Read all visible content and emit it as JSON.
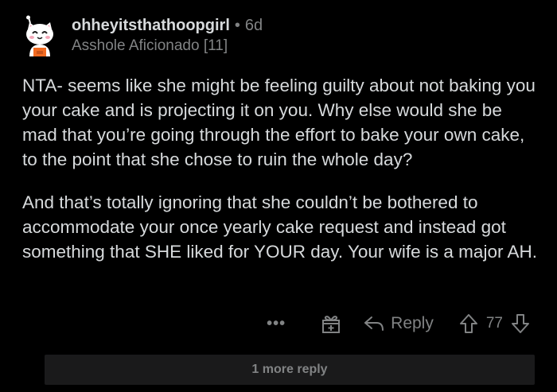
{
  "comment": {
    "username": "ohheyitsthathoopgirl",
    "separator": "•",
    "age": "6d",
    "flair": "Asshole Aficionado [11]",
    "avatar_icon": "cat-avatar-icon",
    "paragraphs": [
      "NTA- seems like she might be feeling guilty about not baking you your cake and is projecting it on you. Why else would she be mad that you’re going through the effort to bake your own cake, to the point that she chose to ruin the whole day?",
      "And that’s totally ignoring that she couldn’t be bothered to accommodate your once yearly cake request and instead got something that SHE liked for YOUR day. Your wife is a major AH."
    ]
  },
  "actions": {
    "more_label": "•••",
    "award_icon": "gift-icon",
    "reply_icon": "reply-arrow-icon",
    "reply_label": "Reply",
    "upvote_icon": "upvote-arrow-icon",
    "score": "77",
    "downvote_icon": "downvote-arrow-icon"
  },
  "replies": {
    "more_replies_label": "1 more reply"
  },
  "colors": {
    "background": "#000000",
    "text": "#d7dadc",
    "muted": "#818384",
    "panel": "#1a1a1b"
  }
}
